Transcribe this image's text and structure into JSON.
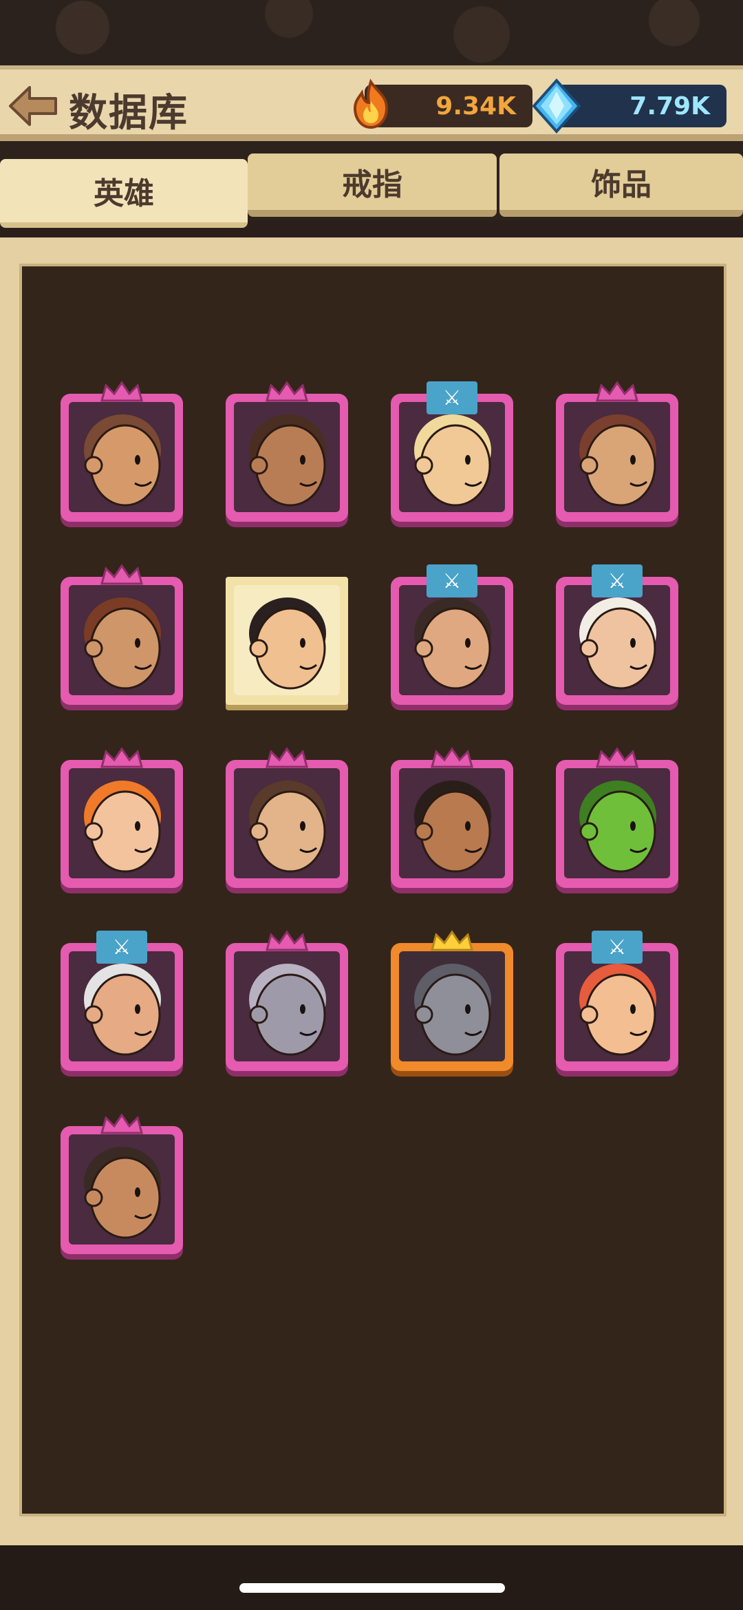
{
  "header": {
    "title": "数据库",
    "gold_amount": "9.34K",
    "gem_amount": "7.79K"
  },
  "tabs": [
    {
      "label": "英雄",
      "active": true
    },
    {
      "label": "戒指",
      "active": false
    },
    {
      "label": "饰品",
      "active": false
    }
  ],
  "heroes": [
    {
      "name": "hero-bald",
      "frame": "pink",
      "top": "crown",
      "skin": "#d69a6a",
      "hair": "#7a4a34"
    },
    {
      "name": "hero-brute",
      "frame": "pink",
      "top": "crown",
      "skin": "#b97d55",
      "hair": "#4a2e22"
    },
    {
      "name": "hero-blonde",
      "frame": "pink",
      "top": "badge",
      "skin": "#f0c997",
      "hair": "#f1d99b"
    },
    {
      "name": "hero-brown-hair",
      "frame": "pink",
      "top": "crown",
      "skin": "#d9a577",
      "hair": "#7b3f2e"
    },
    {
      "name": "hero-bearded-monk",
      "frame": "pink",
      "top": "crown",
      "skin": "#cf966a",
      "hair": "#7a3c24"
    },
    {
      "name": "hero-goggles",
      "frame": "paper",
      "top": "none",
      "skin": "#f0c090",
      "hair": "#2a2020"
    },
    {
      "name": "hero-long-hair",
      "frame": "pink",
      "top": "badge",
      "skin": "#e0a880",
      "hair": "#3a2a26"
    },
    {
      "name": "hero-old-sage",
      "frame": "pink",
      "top": "badge",
      "skin": "#f0c3a0",
      "hair": "#f2eee6"
    },
    {
      "name": "hero-elf-archer",
      "frame": "pink",
      "top": "crown",
      "skin": "#f3c39e",
      "hair": "#f07a2a"
    },
    {
      "name": "hero-bowlcut",
      "frame": "pink",
      "top": "crown",
      "skin": "#e3b489",
      "hair": "#5a3a2a"
    },
    {
      "name": "hero-bandit",
      "frame": "pink",
      "top": "crown",
      "skin": "#b97a50",
      "hair": "#2a1e1a"
    },
    {
      "name": "hero-goblin",
      "frame": "pink",
      "top": "crown",
      "skin": "#6fbf3b",
      "hair": "#3e7f21"
    },
    {
      "name": "hero-granny",
      "frame": "pink",
      "top": "badge",
      "skin": "#e6aa84",
      "hair": "#e3e3e3"
    },
    {
      "name": "hero-ghoul",
      "frame": "pink",
      "top": "crown",
      "skin": "#9f9aaa",
      "hair": "#b7b1c2"
    },
    {
      "name": "hero-gray-beast",
      "frame": "gold",
      "top": "gold-crown",
      "skin": "#8f8f9a",
      "hair": "#5e5e68"
    },
    {
      "name": "hero-redhead",
      "frame": "pink",
      "top": "badge",
      "skin": "#f3be92",
      "hair": "#e65c3c"
    },
    {
      "name": "hero-rogue",
      "frame": "pink",
      "top": "crown",
      "skin": "#c78a5f",
      "hair": "#3a2a24"
    }
  ],
  "icons": {
    "back": "arrow-left-icon",
    "gold": "flame-gold-icon",
    "gem": "diamond-gem-icon",
    "badge": "crossed-swords-icon"
  },
  "colors": {
    "accent_pink": "#e45bb0",
    "accent_gold": "#f08a2a",
    "gold_text": "#f2a63d",
    "gem_text": "#9ee6ff"
  }
}
